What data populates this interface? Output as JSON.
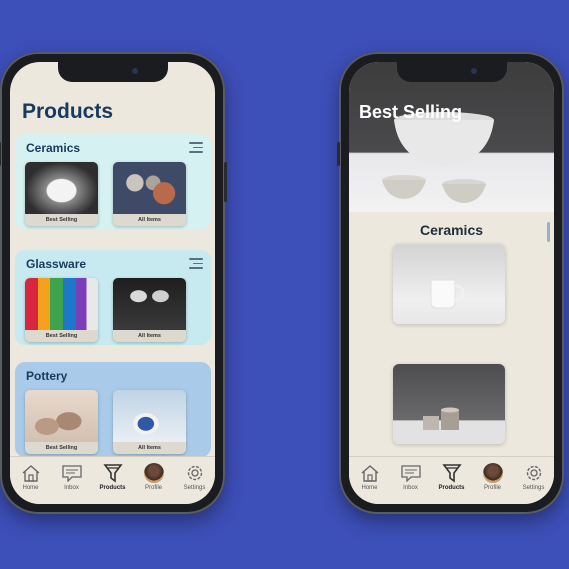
{
  "colors": {
    "background": "#3d4fb8",
    "title": "#173a5e",
    "screen": "#ece8dd"
  },
  "left_screen": {
    "title": "Products",
    "categories": [
      {
        "name": "Ceramics",
        "thumbs": [
          "Best Selling",
          "All Items"
        ]
      },
      {
        "name": "Glassware",
        "thumbs": [
          "Best Selling",
          "All Items"
        ]
      },
      {
        "name": "Pottery",
        "thumbs": [
          "Best Selling",
          "All Items"
        ]
      }
    ],
    "tabs": [
      {
        "label": "Home",
        "icon": "home-icon"
      },
      {
        "label": "Inbox",
        "icon": "inbox-icon"
      },
      {
        "label": "Products",
        "icon": "filter-icon",
        "active": true
      },
      {
        "label": "Profile",
        "icon": "avatar"
      },
      {
        "label": "Settings",
        "icon": "gear-icon"
      }
    ]
  },
  "right_screen": {
    "hero_title": "Best Selling",
    "section_title": "Ceramics",
    "tabs": [
      {
        "label": "Home"
      },
      {
        "label": "Inbox"
      },
      {
        "label": "Products"
      },
      {
        "label": "Profile"
      },
      {
        "label": "Settings"
      }
    ]
  }
}
